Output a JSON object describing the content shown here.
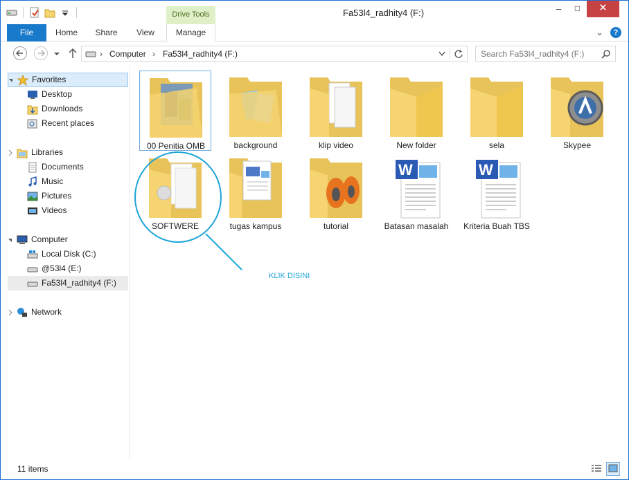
{
  "window": {
    "title": "Fa53l4_radhity4 (F:)",
    "context_tab_group": "Drive Tools",
    "minimize": "–",
    "maximize": "□",
    "close": "✕"
  },
  "ribbon": {
    "tabs": [
      "File",
      "Home",
      "Share",
      "View",
      "Manage"
    ],
    "help": "?",
    "collapse": "⌄"
  },
  "navigation": {
    "breadcrumb": [
      "Computer",
      "Fa53l4_radhity4 (F:)"
    ],
    "search_placeholder": "Search Fa53l4_radhity4 (F:)"
  },
  "sidebar": {
    "favorites": {
      "label": "Favorites",
      "items": [
        "Desktop",
        "Downloads",
        "Recent places"
      ]
    },
    "libraries": {
      "label": "Libraries",
      "items": [
        "Documents",
        "Music",
        "Pictures",
        "Videos"
      ]
    },
    "computer": {
      "label": "Computer",
      "items": [
        "Local Disk (C:)",
        "@53l4 (E:)",
        "Fa53l4_radhity4 (F:)"
      ]
    },
    "network": {
      "label": "Network"
    }
  },
  "content": {
    "items": [
      {
        "name": "00 Penitia OMB",
        "type": "folder-photos"
      },
      {
        "name": "background",
        "type": "folder-photos"
      },
      {
        "name": "klip video",
        "type": "folder-docs"
      },
      {
        "name": "New folder",
        "type": "folder"
      },
      {
        "name": "sela",
        "type": "folder"
      },
      {
        "name": "Skypee",
        "type": "folder-app"
      },
      {
        "name": "SOFTWERE",
        "type": "folder-docs"
      },
      {
        "name": "tugas kampus",
        "type": "folder-docs"
      },
      {
        "name": "tutorial",
        "type": "folder-app"
      },
      {
        "name": "Batasan masalah",
        "type": "word-document"
      },
      {
        "name": "Kriteria Buah TBS",
        "type": "word-document"
      }
    ],
    "annotation": "KLIK DISINI"
  },
  "status": {
    "count": "11 items"
  },
  "colors": {
    "accent": "#1979ca",
    "drive_tools": "#dff0c8",
    "annotation": "#1da4d8",
    "folder": "#f5d471"
  }
}
